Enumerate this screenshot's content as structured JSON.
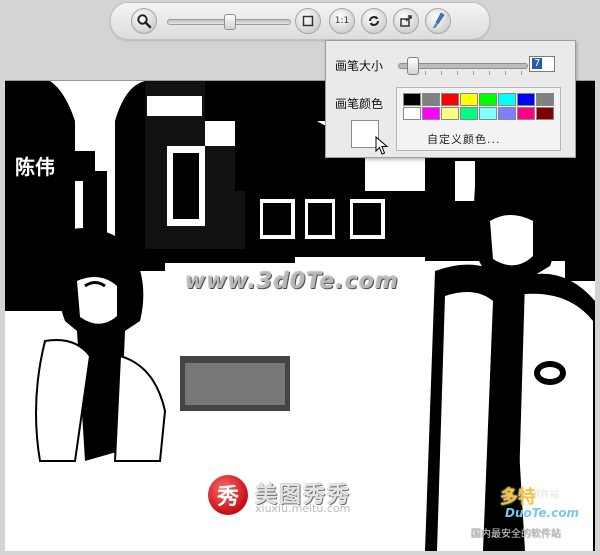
{
  "toolbar": {
    "buttons": [
      {
        "name": "zoom-icon"
      },
      {
        "name": "fit-window-icon"
      },
      {
        "name": "actual-size-button",
        "label": "1:1"
      },
      {
        "name": "rotate-icon"
      },
      {
        "name": "export-icon"
      },
      {
        "name": "brush-icon"
      }
    ],
    "zoom_level": 0.5
  },
  "brush_panel": {
    "size_label": "画笔大小",
    "size_value": "7",
    "color_label": "画笔颜色",
    "current_color": "#ffffff",
    "swatches": [
      "#000000",
      "#808080",
      "#ff0000",
      "#ffff00",
      "#00ff00",
      "#00ffff",
      "#0000ff",
      "#808080",
      "#ffffff",
      "#ff00ff",
      "#ffff80",
      "#00ff80",
      "#80ffff",
      "#8080ff",
      "#ff0080",
      "#800000"
    ],
    "custom_color_label": "自定义颜色..."
  },
  "watermarks": {
    "site_url": "www.3d0Te.com",
    "meitu_logo_char": "秀",
    "meitu_name": "美图秀秀",
    "meitu_url": "xiuxiu.meitu.com",
    "duote_name": "多特",
    "duote_sub": "软件站",
    "duote_url": "DuoTe.com",
    "duote_slogan": "国内最安全的软件站"
  }
}
